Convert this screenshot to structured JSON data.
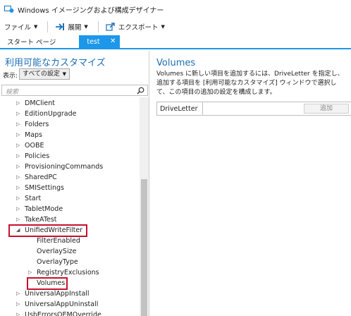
{
  "window": {
    "title": "Windows イメージングおよび構成デザイナー"
  },
  "menu": {
    "file": "ファイル",
    "deploy": "展開",
    "export": "エクスポート"
  },
  "tabs": {
    "start": "スタート ページ",
    "active": "test",
    "close_glyph": "✕"
  },
  "left_pane": {
    "title": "利用可能なカスタマイズ",
    "view_label": "表示:",
    "view_value": "すべての設定",
    "search_placeholder": "検索",
    "tree": [
      {
        "label": "DMClient",
        "arrow": "▷"
      },
      {
        "label": "EditionUpgrade",
        "arrow": "▷"
      },
      {
        "label": "Folders",
        "arrow": "▷"
      },
      {
        "label": "Maps",
        "arrow": "▷"
      },
      {
        "label": "OOBE",
        "arrow": "▷"
      },
      {
        "label": "Policies",
        "arrow": "▷"
      },
      {
        "label": "ProvisioningCommands",
        "arrow": "▷"
      },
      {
        "label": "SharedPC",
        "arrow": "▷"
      },
      {
        "label": "SMISettings",
        "arrow": "▷"
      },
      {
        "label": "Start",
        "arrow": "▷"
      },
      {
        "label": "TabletMode",
        "arrow": "▷"
      },
      {
        "label": "TakeATest",
        "arrow": "▷"
      },
      {
        "label": "UnifiedWriteFilter",
        "arrow": "◢"
      },
      {
        "label": "FilterEnabled",
        "arrow": ""
      },
      {
        "label": "OverlaySize",
        "arrow": ""
      },
      {
        "label": "OverlayType",
        "arrow": ""
      },
      {
        "label": "RegistryExclusions",
        "arrow": "▷"
      },
      {
        "label": "Volumes",
        "arrow": ""
      },
      {
        "label": "UniversalAppInstall",
        "arrow": "▷"
      },
      {
        "label": "UniversalAppUninstall",
        "arrow": "▷"
      },
      {
        "label": "UsbErrorsOEMOverride",
        "arrow": "▷"
      }
    ]
  },
  "right_pane": {
    "title": "Volumes",
    "description": "Volumes に新しい項目を追加するには、DriveLetter を指定し、追加する項目を [利用可能なカスタマイズ] ウィンドウで選択して、この項目の追加の設定を構成します。",
    "field_label": "DriveLetter",
    "field_value": "",
    "add_button": "追加"
  },
  "colors": {
    "accent": "#1c97ea",
    "title_blue": "#1c6fb5",
    "highlight_red": "#c8102e"
  }
}
